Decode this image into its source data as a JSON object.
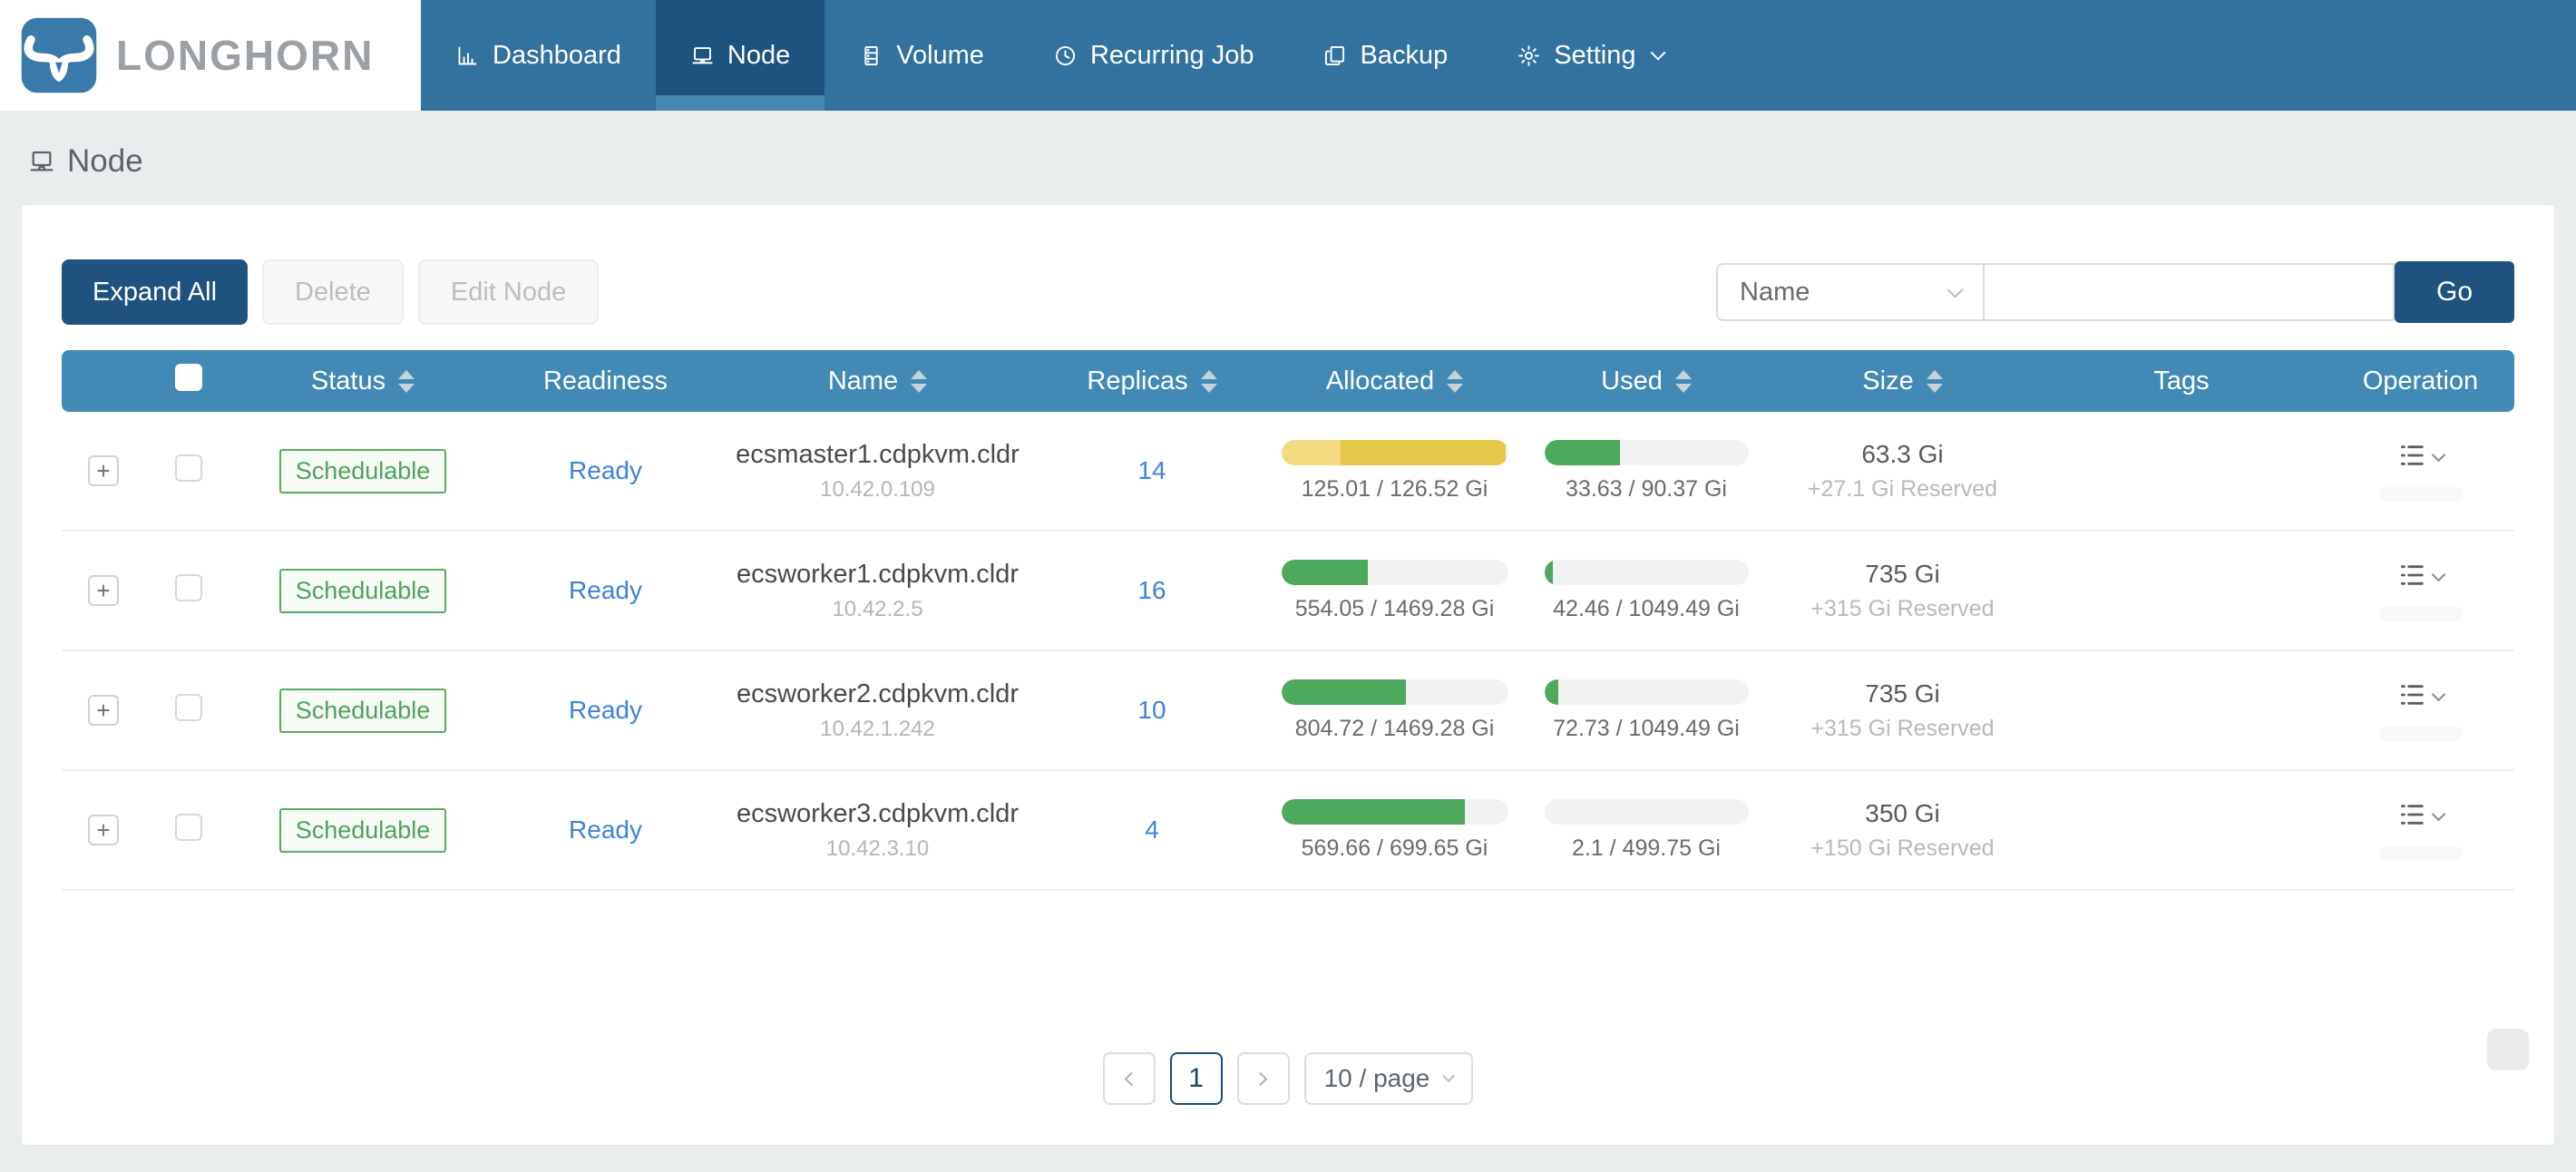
{
  "brand": {
    "name": "LONGHORN"
  },
  "nav": {
    "active": "Node",
    "items": [
      {
        "label": "Dashboard",
        "icon": "bar-chart-icon"
      },
      {
        "label": "Node",
        "icon": "node-icon"
      },
      {
        "label": "Volume",
        "icon": "volume-icon"
      },
      {
        "label": "Recurring Job",
        "icon": "clock-icon"
      },
      {
        "label": "Backup",
        "icon": "backup-icon"
      },
      {
        "label": "Setting",
        "icon": "gear-icon",
        "dropdown": true
      }
    ]
  },
  "breadcrumb": {
    "label": "Node"
  },
  "toolbar": {
    "expand_all_label": "Expand All",
    "delete_label": "Delete",
    "edit_node_label": "Edit Node",
    "filter_field": "Name",
    "search_value": "",
    "go_label": "Go"
  },
  "table": {
    "expand_glyph": "+",
    "headers": [
      {
        "label": "Status",
        "sortable": true
      },
      {
        "label": "Readiness",
        "sortable": false
      },
      {
        "label": "Name",
        "sortable": true
      },
      {
        "label": "Replicas",
        "sortable": true
      },
      {
        "label": "Allocated",
        "sortable": true
      },
      {
        "label": "Used",
        "sortable": true
      },
      {
        "label": "Size",
        "sortable": true
      },
      {
        "label": "Tags",
        "sortable": false
      },
      {
        "label": "Operation",
        "sortable": false
      }
    ],
    "rows": [
      {
        "status": "Schedulable",
        "readiness": "Ready",
        "name": "ecsmaster1.cdpkvm.cldr",
        "ip": "10.42.0.109",
        "replicas": "14",
        "allocated": {
          "label": "125.01 / 126.52 Gi",
          "segments": [
            {
              "color": "#f3da81",
              "pct": 26
            },
            {
              "color": "#e7c74a",
              "pct": 73
            }
          ]
        },
        "used": {
          "label": "33.63 / 90.37 Gi",
          "pct": 37,
          "color": "#4fa95c"
        },
        "size": "63.3 Gi",
        "reserved": "+27.1 Gi Reserved",
        "tags": ""
      },
      {
        "status": "Schedulable",
        "readiness": "Ready",
        "name": "ecsworker1.cdpkvm.cldr",
        "ip": "10.42.2.5",
        "replicas": "16",
        "allocated": {
          "label": "554.05 / 1469.28 Gi",
          "segments": [
            {
              "color": "#4fa95c",
              "pct": 38
            }
          ]
        },
        "used": {
          "label": "42.46 / 1049.49 Gi",
          "pct": 4,
          "color": "#4fa95c"
        },
        "size": "735 Gi",
        "reserved": "+315 Gi Reserved",
        "tags": ""
      },
      {
        "status": "Schedulable",
        "readiness": "Ready",
        "name": "ecsworker2.cdpkvm.cldr",
        "ip": "10.42.1.242",
        "replicas": "10",
        "allocated": {
          "label": "804.72 / 1469.28 Gi",
          "segments": [
            {
              "color": "#4fa95c",
              "pct": 55
            }
          ]
        },
        "used": {
          "label": "72.73 / 1049.49 Gi",
          "pct": 7,
          "color": "#4fa95c"
        },
        "size": "735 Gi",
        "reserved": "+315 Gi Reserved",
        "tags": ""
      },
      {
        "status": "Schedulable",
        "readiness": "Ready",
        "name": "ecsworker3.cdpkvm.cldr",
        "ip": "10.42.3.10",
        "replicas": "4",
        "allocated": {
          "label": "569.66 / 699.65 Gi",
          "segments": [
            {
              "color": "#4fa95c",
              "pct": 81
            }
          ]
        },
        "used": {
          "label": "2.1 / 499.75 Gi",
          "pct": 0,
          "color": "#4fa95c"
        },
        "size": "350 Gi",
        "reserved": "+150 Gi Reserved",
        "tags": ""
      }
    ]
  },
  "pagination": {
    "current": "1",
    "page_size": "10 / page"
  },
  "colors": {
    "nav": "#33719f",
    "nav_active": "#1e537f",
    "table_header": "#428ab5",
    "primary_button": "#1f527e",
    "link": "#3f83d8",
    "status_green": "#50ad59",
    "bar_green": "#4fa95c",
    "bar_yellow": "#e7c74a",
    "bar_yellow_light": "#f3da81"
  }
}
